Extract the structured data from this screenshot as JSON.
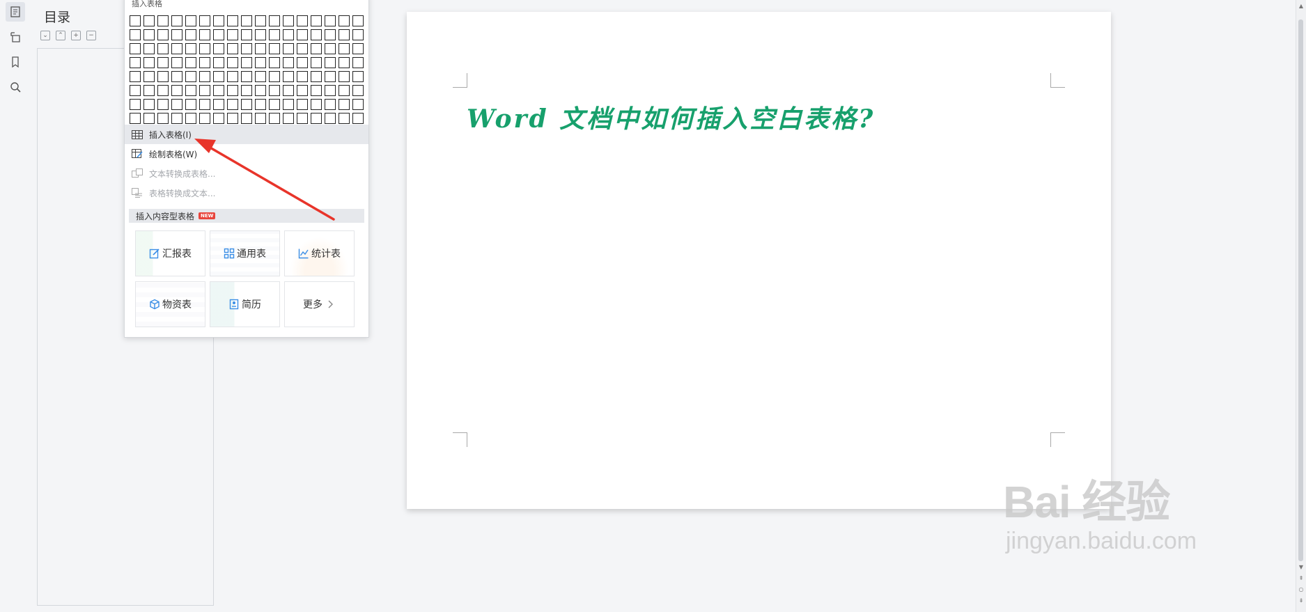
{
  "toc": {
    "title": "目录",
    "tools": [
      {
        "icon": "expand-all-icon",
        "glyph": "⌄"
      },
      {
        "icon": "collapse-all-icon",
        "glyph": "⌃"
      },
      {
        "icon": "add-heading-icon",
        "glyph": "+"
      },
      {
        "icon": "remove-heading-icon",
        "glyph": "−"
      }
    ]
  },
  "rail": {
    "items": [
      {
        "icon": "outline-icon",
        "active": true
      },
      {
        "icon": "navigation-icon",
        "active": false
      },
      {
        "icon": "bookmark-icon",
        "active": false
      },
      {
        "icon": "search-icon",
        "active": false
      }
    ]
  },
  "document": {
    "heading": "Word 文档中如何插入空白表格?",
    "heading_color": "#17a06c"
  },
  "dropdown": {
    "header": "插入表格",
    "grid": {
      "columns": 17,
      "rows": 8
    },
    "menu": [
      {
        "label": "插入表格(I)",
        "icon": "table-icon",
        "state": "hover"
      },
      {
        "label": "绘制表格(W)",
        "icon": "draw-table-icon",
        "state": "normal"
      },
      {
        "label": "文本转换成表格...",
        "icon": "text-to-table-icon",
        "state": "disabled"
      },
      {
        "label": "表格转换成文本...",
        "icon": "table-to-text-icon",
        "state": "disabled"
      }
    ],
    "section": {
      "label": "插入内容型表格",
      "badge": "NEW"
    },
    "cards": [
      {
        "label": "汇报表",
        "icon": "report-icon"
      },
      {
        "label": "通用表",
        "icon": "grid-icon"
      },
      {
        "label": "统计表",
        "icon": "chart-icon"
      },
      {
        "label": "物资表",
        "icon": "box-icon"
      },
      {
        "label": "简历",
        "icon": "resume-icon"
      },
      {
        "label": "更多",
        "icon": "chevron-right-icon"
      }
    ]
  },
  "annotation": {
    "arrow_color": "#e8342a"
  },
  "watermark": {
    "logo": "Bai 经验",
    "url": "jingyan.baidu.com"
  },
  "colors": {
    "accent_blue": "#3a8ee6",
    "badge_red": "#e8453c"
  }
}
